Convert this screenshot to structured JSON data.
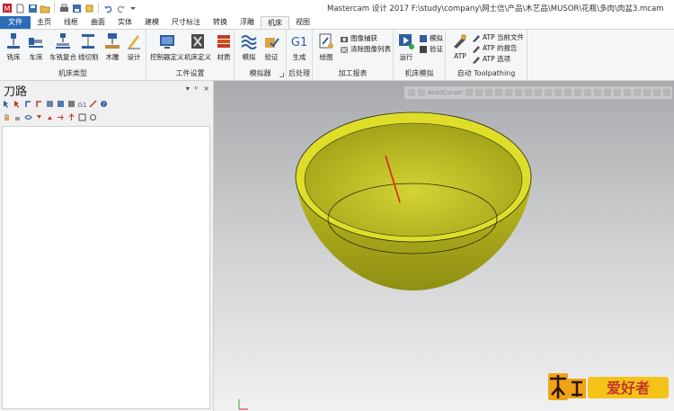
{
  "window": {
    "title": "Mastercam 设计 2017  F:\\study\\company\\网士信\\产品\\木艺品\\MUSOR\\花瓶\\多肉\\肉盆3.mcam"
  },
  "tabs": [
    {
      "label": "文件"
    },
    {
      "label": "主页"
    },
    {
      "label": "线框"
    },
    {
      "label": "曲面"
    },
    {
      "label": "实体"
    },
    {
      "label": "建模"
    },
    {
      "label": "尺寸标注"
    },
    {
      "label": "转换"
    },
    {
      "label": "浮雕"
    },
    {
      "label": "机床"
    },
    {
      "label": "视图"
    }
  ],
  "ribbon": {
    "machine_type": {
      "label": "机床类型",
      "buttons": [
        "铣床",
        "车床",
        "车铣复合",
        "线切割",
        "木雕",
        "设计"
      ]
    },
    "work_setup": {
      "label": "工件设置",
      "buttons": [
        "控制器定义",
        "机床定义",
        "材质"
      ]
    },
    "simulator": {
      "label": "模拟器",
      "buttons": [
        "模拟",
        "验证"
      ]
    },
    "post": {
      "label": "后处理",
      "buttons": [
        "生成"
      ]
    },
    "report": {
      "label": "加工报表",
      "buttons": [
        "绘图"
      ],
      "small": [
        "图像捕获",
        "清除图像列表"
      ]
    },
    "machine_sim": {
      "label": "机床模拟",
      "buttons": [
        "运行"
      ],
      "small": [
        "模拟",
        "验证"
      ]
    },
    "auto": {
      "label": "自动 Toolpathing",
      "buttons": [
        "ATP"
      ],
      "small": [
        "ATP 当前文件",
        "ATP 的报告",
        "ATP 选项"
      ]
    }
  },
  "left_pane": {
    "title": "刀路",
    "controls": [
      "▾",
      "ᵖ",
      "×"
    ]
  },
  "viewport": {
    "toolbar_text": "AutoCursor"
  },
  "watermark": {
    "text": "木工爱好者"
  },
  "colors": {
    "accent": "#2b6cb8",
    "model": "#dede2a",
    "toolpath": "#e0201a"
  }
}
